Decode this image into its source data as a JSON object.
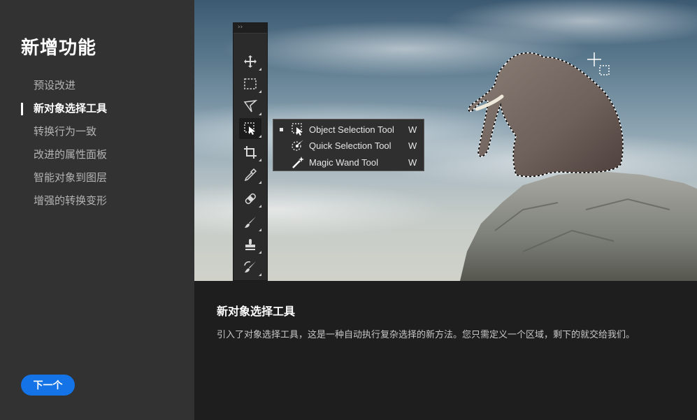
{
  "sidebar": {
    "title": "新增功能",
    "items": [
      {
        "label": "预设改进",
        "active": false
      },
      {
        "label": "新对象选择工具",
        "active": true
      },
      {
        "label": "转换行为一致",
        "active": false
      },
      {
        "label": "改进的属性面板",
        "active": false
      },
      {
        "label": "智能对象到图层",
        "active": false
      },
      {
        "label": "增强的转换变形",
        "active": false
      }
    ],
    "next_button": "下一个"
  },
  "toolbar": {
    "header": "››",
    "tools": [
      "move-icon",
      "marquee-icon",
      "lasso-icon",
      "object-selection-icon",
      "crop-icon",
      "eyedropper-icon",
      "healing-brush-icon",
      "brush-icon",
      "stamp-icon",
      "history-brush-icon"
    ]
  },
  "flyout": {
    "items": [
      {
        "label": "Object Selection Tool",
        "shortcut": "W",
        "icon": "object-selection-icon",
        "current": true
      },
      {
        "label": "Quick Selection Tool",
        "shortcut": "W",
        "icon": "quick-selection-icon",
        "current": false
      },
      {
        "label": "Magic Wand Tool",
        "shortcut": "W",
        "icon": "magic-wand-icon",
        "current": false
      }
    ]
  },
  "info": {
    "title": "新对象选择工具",
    "description": "引入了对象选择工具，这是一种自动执行复杂选择的新方法。您只需定义一个区域，剩下的就交给我们。"
  },
  "colors": {
    "sidebar_bg": "#323232",
    "panel_bg": "#1e1e1e",
    "accent": "#1473e6"
  }
}
